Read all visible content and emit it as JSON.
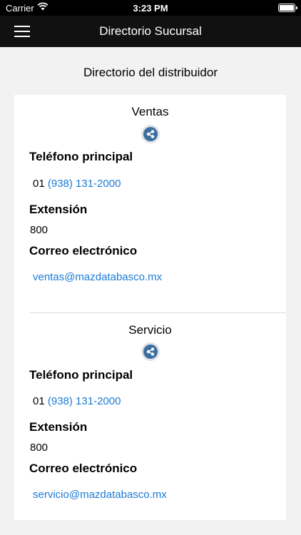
{
  "status_bar": {
    "carrier": "Carrier",
    "time": "3:23 PM"
  },
  "nav": {
    "title": "Directorio Sucursal"
  },
  "page": {
    "heading": "Directorio del distribuidor"
  },
  "sections": [
    {
      "title": "Ventas",
      "phone_label": "Teléfono principal",
      "phone_prefix": "01",
      "phone_number": "(938) 131-2000",
      "extension_label": "Extensión",
      "extension": "800",
      "email_label": "Correo electrónico",
      "email": "ventas@mazdatabasco.mx"
    },
    {
      "title": "Servicio",
      "phone_label": "Teléfono principal",
      "phone_prefix": "01",
      "phone_number": "(938) 131-2000",
      "extension_label": "Extensión",
      "extension": "800",
      "email_label": "Correo electrónico",
      "email": "servicio@mazdatabasco.mx"
    }
  ],
  "colors": {
    "link": "#1a7cd6",
    "navbar": "#111111",
    "share": "#3c6ea0"
  }
}
